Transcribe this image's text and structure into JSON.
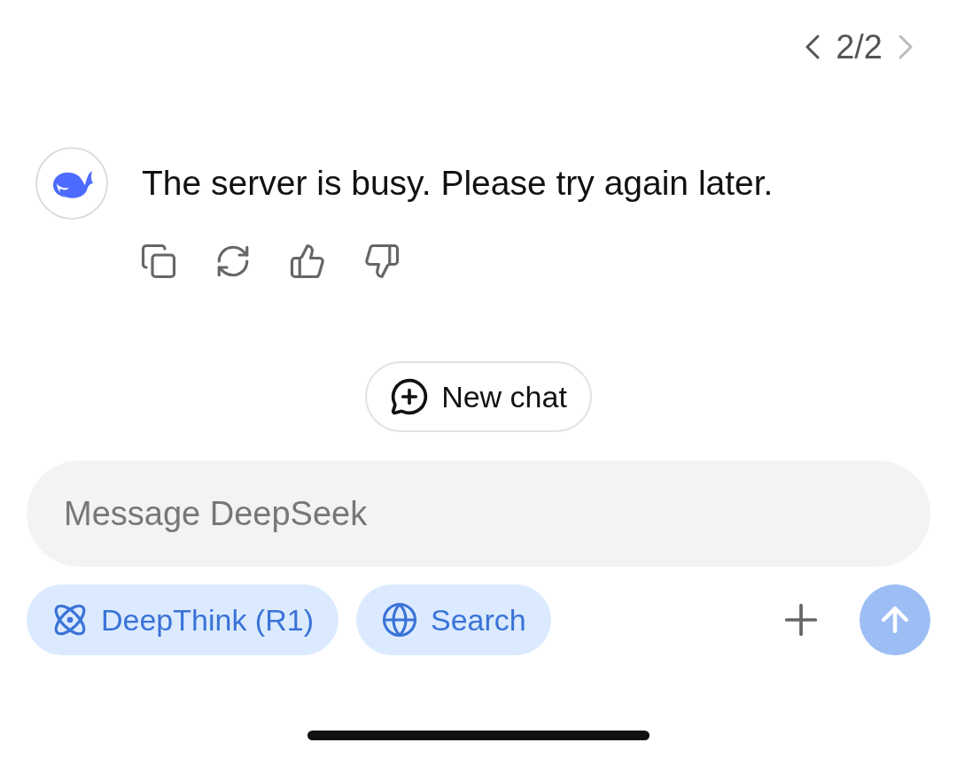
{
  "pager": {
    "text": "2/2",
    "prev_disabled": false,
    "next_disabled": true
  },
  "message": {
    "text": "The server is busy. Please try again later."
  },
  "actions": [
    {
      "kind": "copy"
    },
    {
      "kind": "regenerate"
    },
    {
      "kind": "like"
    },
    {
      "kind": "dislike"
    }
  ],
  "new_chat": {
    "label": "New chat"
  },
  "composer": {
    "placeholder": "Message DeepSeek"
  },
  "toggles": [
    {
      "kind": "deepthink",
      "label": "DeepThink (R1)",
      "selected": true
    },
    {
      "kind": "search",
      "label": "Search",
      "selected": true
    }
  ],
  "send": {
    "disabled": true
  }
}
